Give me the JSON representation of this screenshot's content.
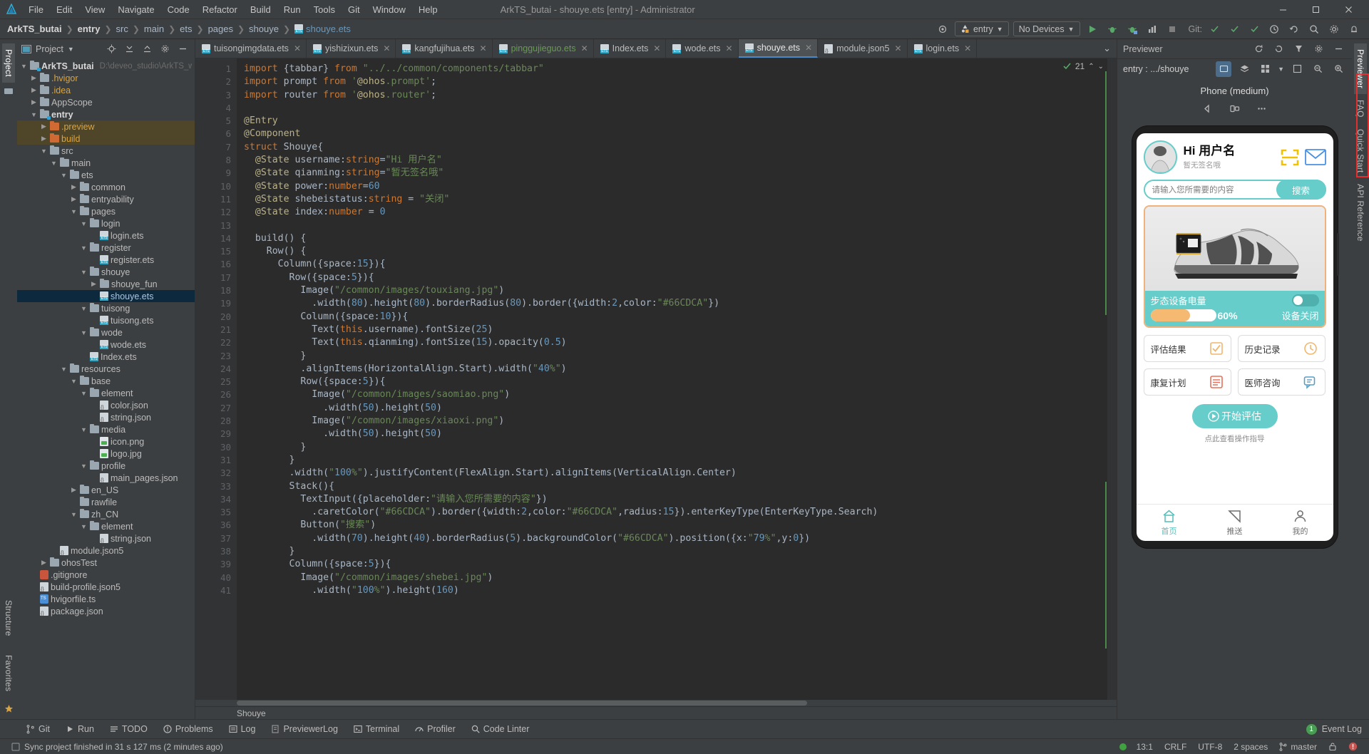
{
  "window": {
    "title": "ArkTS_butai - shouye.ets [entry] - Administrator",
    "menu": [
      "File",
      "Edit",
      "View",
      "Navigate",
      "Code",
      "Refactor",
      "Build",
      "Run",
      "Tools",
      "Git",
      "Window",
      "Help"
    ],
    "controls": {
      "minimize": "—",
      "maximize": "❐",
      "close": "✕"
    }
  },
  "breadcrumb": {
    "items": [
      "ArkTS_butai",
      "entry",
      "src",
      "main",
      "ets",
      "pages",
      "shouye"
    ],
    "file": "shouye.ets"
  },
  "toolbar": {
    "run_config": "entry",
    "device": "No Devices",
    "git_label": "Git:",
    "icons": [
      "target-icon",
      "run-icon",
      "debug-icon",
      "profile-icon",
      "stop-icon",
      "search-everywhere-icon",
      "settings-icon",
      "notifications-icon"
    ]
  },
  "project_panel": {
    "title": "Project",
    "root": "ArkTS_butai",
    "root_path": "D:\\deveo_studio\\ArkTS_work\\Ark",
    "tree": [
      {
        "label": "ArkTS_butai",
        "indent": 0,
        "arrow": "down",
        "icon": "folder-module",
        "style": "bold",
        "path": "D:\\deveo_studio\\ArkTS_work\\Ark"
      },
      {
        "label": ".hvigor",
        "indent": 1,
        "arrow": "right",
        "icon": "folder",
        "style": "orange"
      },
      {
        "label": ".idea",
        "indent": 1,
        "arrow": "right",
        "icon": "folder",
        "style": "orange"
      },
      {
        "label": "AppScope",
        "indent": 1,
        "arrow": "right",
        "icon": "folder",
        "style": "normal"
      },
      {
        "label": "entry",
        "indent": 1,
        "arrow": "down",
        "icon": "folder-module",
        "style": "bold"
      },
      {
        "label": ".preview",
        "indent": 2,
        "arrow": "right",
        "icon": "folder-orange",
        "style": "orange",
        "highlight": true
      },
      {
        "label": "build",
        "indent": 2,
        "arrow": "right",
        "icon": "folder-orange",
        "style": "orange",
        "highlight": true
      },
      {
        "label": "src",
        "indent": 2,
        "arrow": "down",
        "icon": "folder",
        "style": "normal"
      },
      {
        "label": "main",
        "indent": 3,
        "arrow": "down",
        "icon": "folder",
        "style": "normal"
      },
      {
        "label": "ets",
        "indent": 4,
        "arrow": "down",
        "icon": "folder",
        "style": "normal"
      },
      {
        "label": "common",
        "indent": 5,
        "arrow": "right",
        "icon": "folder",
        "style": "normal"
      },
      {
        "label": "entryability",
        "indent": 5,
        "arrow": "right",
        "icon": "folder",
        "style": "normal"
      },
      {
        "label": "pages",
        "indent": 5,
        "arrow": "down",
        "icon": "folder",
        "style": "normal"
      },
      {
        "label": "login",
        "indent": 6,
        "arrow": "down",
        "icon": "folder",
        "style": "normal"
      },
      {
        "label": "login.ets",
        "indent": 7,
        "arrow": "none",
        "icon": "ets",
        "style": "normal"
      },
      {
        "label": "register",
        "indent": 6,
        "arrow": "down",
        "icon": "folder",
        "style": "normal"
      },
      {
        "label": "register.ets",
        "indent": 7,
        "arrow": "none",
        "icon": "ets",
        "style": "normal"
      },
      {
        "label": "shouye",
        "indent": 6,
        "arrow": "down",
        "icon": "folder",
        "style": "normal"
      },
      {
        "label": "shouye_fun",
        "indent": 7,
        "arrow": "right",
        "icon": "folder",
        "style": "normal"
      },
      {
        "label": "shouye.ets",
        "indent": 7,
        "arrow": "none",
        "icon": "ets",
        "style": "blue",
        "selected": true
      },
      {
        "label": "tuisong",
        "indent": 6,
        "arrow": "down",
        "icon": "folder",
        "style": "normal"
      },
      {
        "label": "tuisong.ets",
        "indent": 7,
        "arrow": "none",
        "icon": "ets",
        "style": "normal"
      },
      {
        "label": "wode",
        "indent": 6,
        "arrow": "down",
        "icon": "folder",
        "style": "normal"
      },
      {
        "label": "wode.ets",
        "indent": 7,
        "arrow": "none",
        "icon": "ets",
        "style": "normal"
      },
      {
        "label": "Index.ets",
        "indent": 6,
        "arrow": "none",
        "icon": "ets",
        "style": "normal"
      },
      {
        "label": "resources",
        "indent": 4,
        "arrow": "down",
        "icon": "folder",
        "style": "normal"
      },
      {
        "label": "base",
        "indent": 5,
        "arrow": "down",
        "icon": "folder",
        "style": "normal"
      },
      {
        "label": "element",
        "indent": 6,
        "arrow": "down",
        "icon": "folder",
        "style": "normal"
      },
      {
        "label": "color.json",
        "indent": 7,
        "arrow": "none",
        "icon": "json",
        "style": "normal"
      },
      {
        "label": "string.json",
        "indent": 7,
        "arrow": "none",
        "icon": "json",
        "style": "normal"
      },
      {
        "label": "media",
        "indent": 6,
        "arrow": "down",
        "icon": "folder",
        "style": "normal"
      },
      {
        "label": "icon.png",
        "indent": 7,
        "arrow": "none",
        "icon": "img",
        "style": "normal"
      },
      {
        "label": "logo.jpg",
        "indent": 7,
        "arrow": "none",
        "icon": "img",
        "style": "normal"
      },
      {
        "label": "profile",
        "indent": 6,
        "arrow": "down",
        "icon": "folder",
        "style": "normal"
      },
      {
        "label": "main_pages.json",
        "indent": 7,
        "arrow": "none",
        "icon": "json",
        "style": "normal"
      },
      {
        "label": "en_US",
        "indent": 5,
        "arrow": "right",
        "icon": "folder",
        "style": "normal"
      },
      {
        "label": "rawfile",
        "indent": 5,
        "arrow": "none",
        "icon": "folder",
        "style": "normal"
      },
      {
        "label": "zh_CN",
        "indent": 5,
        "arrow": "down",
        "icon": "folder",
        "style": "normal"
      },
      {
        "label": "element",
        "indent": 6,
        "arrow": "down",
        "icon": "folder",
        "style": "normal"
      },
      {
        "label": "string.json",
        "indent": 7,
        "arrow": "none",
        "icon": "json",
        "style": "normal"
      },
      {
        "label": "module.json5",
        "indent": 3,
        "arrow": "none",
        "icon": "json",
        "style": "normal"
      },
      {
        "label": "ohosTest",
        "indent": 2,
        "arrow": "right",
        "icon": "folder",
        "style": "normal"
      },
      {
        "label": ".gitignore",
        "indent": 1,
        "arrow": "none",
        "icon": "git",
        "style": "normal"
      },
      {
        "label": "build-profile.json5",
        "indent": 1,
        "arrow": "none",
        "icon": "json",
        "style": "normal"
      },
      {
        "label": "hvigorfile.ts",
        "indent": 1,
        "arrow": "none",
        "icon": "ts",
        "style": "normal"
      },
      {
        "label": "package.json",
        "indent": 1,
        "arrow": "none",
        "icon": "json",
        "style": "normal"
      }
    ]
  },
  "left_rail": {
    "items": [
      "Project",
      "Structure",
      "Favorites"
    ]
  },
  "right_rail": {
    "items": [
      "Previewer",
      "FAQ",
      "Quick Start",
      "API Reference"
    ]
  },
  "editor": {
    "tabs": [
      {
        "label": "tuisongimgdata.ets",
        "icon": "ets",
        "active": false,
        "modified": false
      },
      {
        "label": "yishizixun.ets",
        "icon": "ets",
        "active": false,
        "modified": false
      },
      {
        "label": "kangfujihua.ets",
        "icon": "ets",
        "active": false,
        "modified": false
      },
      {
        "label": "pinggujieguo.ets",
        "icon": "ets",
        "active": false,
        "modified": true
      },
      {
        "label": "Index.ets",
        "icon": "ets",
        "active": false,
        "modified": false
      },
      {
        "label": "wode.ets",
        "icon": "ets",
        "active": false,
        "modified": false
      },
      {
        "label": "shouye.ets",
        "icon": "ets",
        "active": true,
        "modified": false
      },
      {
        "label": "module.json5",
        "icon": "json",
        "active": false,
        "modified": false
      },
      {
        "label": "login.ets",
        "icon": "ets",
        "active": false,
        "modified": false
      }
    ],
    "warning_count": "21",
    "breadcrumb_status": "Shouye",
    "first_line": 1,
    "lines": [
      "import {tabbar} from \"../../common/components/tabbar\"",
      "import prompt from '@ohos.prompt';",
      "import router from '@ohos.router';",
      "",
      "@Entry",
      "@Component",
      "struct Shouye{",
      "  @State username:string=\"Hi 用户名\"",
      "  @State qianming:string=\"暂无签名哦\"",
      "  @State power:number=60",
      "  @State shebeistatus:string = \"关闭\"",
      "  @State index:number = 0",
      "",
      "  build() {",
      "    Row() {",
      "      Column({space:15}){",
      "        Row({space:5}){",
      "          Image(\"/common/images/touxiang.jpg\")",
      "            .width(80).height(80).borderRadius(80).border({width:2,color:\"#66CDCA\"})",
      "          Column({space:10}){",
      "            Text(this.username).fontSize(25)",
      "            Text(this.qianming).fontSize(15).opacity(0.5)",
      "          }",
      "          .alignItems(HorizontalAlign.Start).width(\"40%\")",
      "          Row({space:5}){",
      "            Image(\"/common/images/saomiao.png\")",
      "              .width(50).height(50)",
      "            Image(\"/common/images/xiaoxi.png\")",
      "              .width(50).height(50)",
      "          }",
      "        }",
      "        .width(\"100%\").justifyContent(FlexAlign.Start).alignItems(VerticalAlign.Center)",
      "        Stack(){",
      "          TextInput({placeholder:\"请输入您所需要的内容\"})",
      "            .caretColor(\"#66CDCA\").border({width:2,color:\"#66CDCA\",radius:15}).enterKeyType(EnterKeyType.Search)",
      "          Button(\"搜索\")",
      "            .width(70).height(40).borderRadius(5).backgroundColor(\"#66CDCA\").position({x:\"79%\",y:0})",
      "        }",
      "        Column({space:5}){",
      "          Image(\"/common/images/shebei.jpg\")",
      "            .width(\"100%\").height(160)"
    ]
  },
  "previewer": {
    "title": "Previewer",
    "path_label": "entry : .../shouye",
    "device_name": "Phone (medium)",
    "controls": [
      "rotate-icon",
      "multi-device-icon",
      "more-icon"
    ],
    "app": {
      "username": "Hi 用户名",
      "signature": "暂无签名哦",
      "header_icons": [
        "scan-icon",
        "mail-icon"
      ],
      "search_placeholder": "请输入您所需要的内容",
      "search_button": "搜索",
      "battery_label": "步态设备电量",
      "battery_percent": "60%",
      "battery_value": 60,
      "device_status": "设备关闭",
      "grid_buttons": [
        {
          "label": "评估结果",
          "icon": "checklist-icon"
        },
        {
          "label": "历史记录",
          "icon": "clock-icon"
        },
        {
          "label": "康复计划",
          "icon": "plan-icon"
        },
        {
          "label": "医师咨询",
          "icon": "consult-icon"
        }
      ],
      "start_button": "开始评估",
      "start_hint": "点此查看操作指导",
      "tabbar": [
        {
          "label": "首页",
          "icon": "home-icon",
          "active": true
        },
        {
          "label": "推送",
          "icon": "push-icon",
          "active": false
        },
        {
          "label": "我的",
          "icon": "person-icon",
          "active": false
        }
      ]
    },
    "accent_color": "#66CDCA",
    "card_border_color": "#F0B27A",
    "progress_color": "#F5B971"
  },
  "bottom_bar": {
    "items": [
      {
        "label": "Git",
        "icon": "git-icon"
      },
      {
        "label": "Run",
        "icon": "run-icon"
      },
      {
        "label": "TODO",
        "icon": "todo-icon"
      },
      {
        "label": "Problems",
        "icon": "problems-icon"
      },
      {
        "label": "Log",
        "icon": "log-icon"
      },
      {
        "label": "PreviewerLog",
        "icon": "previewerlog-icon"
      },
      {
        "label": "Terminal",
        "icon": "terminal-icon"
      },
      {
        "label": "Profiler",
        "icon": "profiler-icon"
      },
      {
        "label": "Code Linter",
        "icon": "linter-icon"
      }
    ],
    "event_log": "Event Log",
    "event_count": "1"
  },
  "status_bar": {
    "message": "Sync project finished in 31 s 127 ms (2 minutes ago)",
    "caret": "13:1",
    "line_ending": "CRLF",
    "encoding": "UTF-8",
    "indent": "2 spaces",
    "branch": "master",
    "lock_icon": "lock-icon",
    "error_icon": "error-icon"
  }
}
